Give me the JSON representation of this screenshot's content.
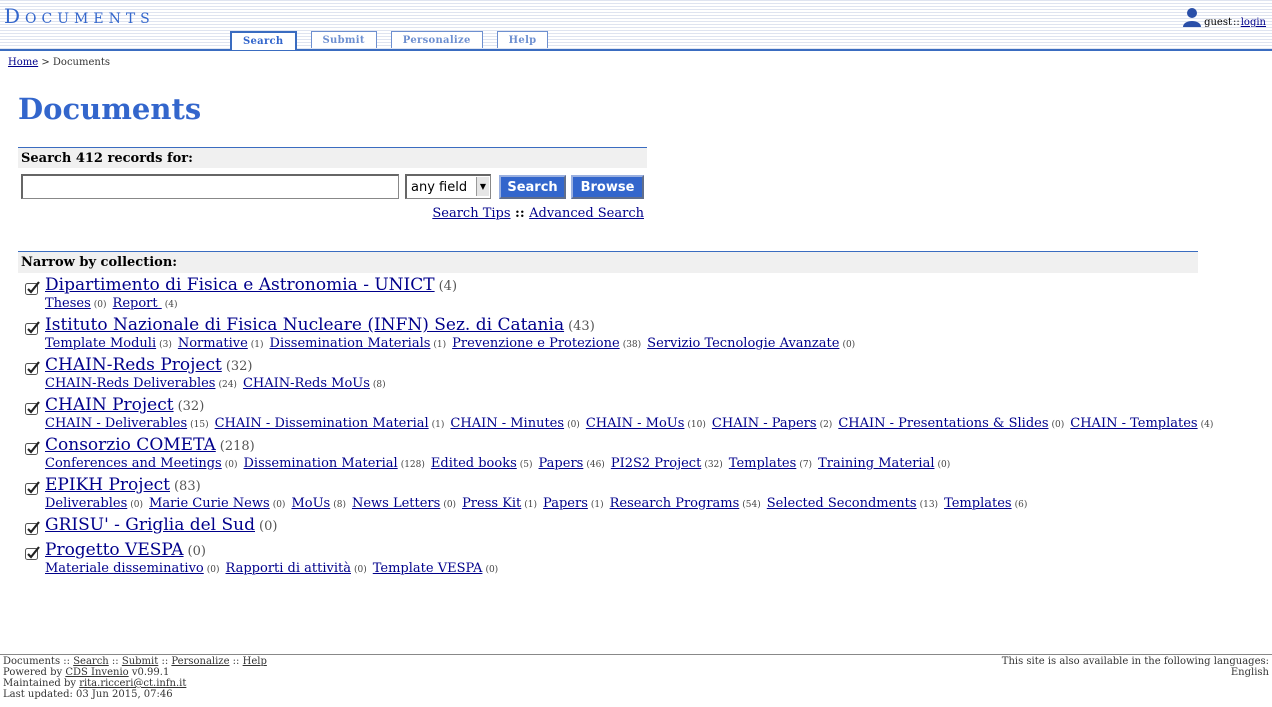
{
  "header": {
    "logo": "Documents",
    "user": "guest",
    "user_sep": " :: ",
    "login": "login",
    "tabs": [
      "Search",
      "Submit",
      "Personalize",
      "Help"
    ]
  },
  "breadcrumb": {
    "home": "Home",
    "sep": " > ",
    "current": "Documents"
  },
  "page_title": "Documents",
  "search": {
    "heading": "Search 412 records for:",
    "input_value": "",
    "field_select": "any field",
    "search_button": "Search",
    "browse_button": "Browse",
    "tips": "Search Tips",
    "links_sep": " :: ",
    "advanced": "Advanced Search"
  },
  "narrow": {
    "heading": "Narrow by collection:",
    "collections": [
      {
        "name": "Dipartimento di Fisica e Astronomia - UNICT",
        "count": "(4)",
        "children": [
          {
            "name": "Theses",
            "count": "(0)"
          },
          {
            "name": "Report ",
            "count": "(4)"
          }
        ]
      },
      {
        "name": "Istituto Nazionale di Fisica Nucleare (INFN) Sez. di Catania",
        "count": "(43)",
        "children": [
          {
            "name": "Template Moduli",
            "count": "(3)"
          },
          {
            "name": "Normative",
            "count": "(1)"
          },
          {
            "name": "Dissemination Materials",
            "count": "(1)"
          },
          {
            "name": "Prevenzione e Protezione",
            "count": "(38)"
          },
          {
            "name": "Servizio Tecnologie Avanzate",
            "count": "(0)"
          }
        ]
      },
      {
        "name": "CHAIN-Reds Project",
        "count": "(32)",
        "children": [
          {
            "name": "CHAIN-Reds Deliverables",
            "count": "(24)"
          },
          {
            "name": "CHAIN-Reds MoUs",
            "count": "(8)"
          }
        ]
      },
      {
        "name": "CHAIN Project",
        "count": "(32)",
        "children": [
          {
            "name": "CHAIN - Deliverables",
            "count": "(15)"
          },
          {
            "name": "CHAIN - Dissemination Material",
            "count": "(1)"
          },
          {
            "name": "CHAIN - Minutes",
            "count": "(0)"
          },
          {
            "name": "CHAIN - MoUs",
            "count": "(10)"
          },
          {
            "name": "CHAIN - Papers",
            "count": "(2)"
          },
          {
            "name": "CHAIN - Presentations & Slides",
            "count": "(0)"
          },
          {
            "name": "CHAIN - Templates",
            "count": "(4)"
          }
        ]
      },
      {
        "name": "Consorzio COMETA",
        "count": "(218)",
        "children": [
          {
            "name": "Conferences and Meetings",
            "count": "(0)"
          },
          {
            "name": "Dissemination Material",
            "count": "(128)"
          },
          {
            "name": "Edited books",
            "count": "(5)"
          },
          {
            "name": "Papers",
            "count": "(46)"
          },
          {
            "name": "PI2S2 Project",
            "count": "(32)"
          },
          {
            "name": "Templates",
            "count": "(7)"
          },
          {
            "name": "Training Material",
            "count": "(0)"
          }
        ]
      },
      {
        "name": "EPIKH Project",
        "count": "(83)",
        "children": [
          {
            "name": "Deliverables",
            "count": "(0)"
          },
          {
            "name": "Marie Curie News",
            "count": "(0)"
          },
          {
            "name": "MoUs",
            "count": "(8)"
          },
          {
            "name": "News Letters",
            "count": "(0)"
          },
          {
            "name": "Press Kit",
            "count": "(1)"
          },
          {
            "name": "Papers",
            "count": "(1)"
          },
          {
            "name": "Research Programs",
            "count": "(54)"
          },
          {
            "name": "Selected Secondments",
            "count": "(13)"
          },
          {
            "name": "Templates",
            "count": "(6)"
          }
        ]
      },
      {
        "name": "GRISU' - Griglia del Sud",
        "count": "(0)",
        "children": []
      },
      {
        "name": "Progetto VESPA",
        "count": "(0)",
        "children": [
          {
            "name": "Materiale disseminativo",
            "count": "(0)"
          },
          {
            "name": "Rapporti di attività",
            "count": "(0)"
          },
          {
            "name": "Template VESPA",
            "count": "(0)"
          }
        ]
      }
    ]
  },
  "footer": {
    "site": "Documents",
    "sep": " :: ",
    "links": [
      "Search",
      "Submit",
      "Personalize",
      "Help"
    ],
    "powered_prefix": "Powered by ",
    "powered_link": "CDS Invenio",
    "powered_version": " v0.99.1",
    "maintained_prefix": "Maintained by ",
    "maintainer": "rita.ricceri@ct.infn.it",
    "updated": "Last updated: 03 Jun 2015, 07:46",
    "languages_text": "This site is also available in the following languages:",
    "language": "English"
  }
}
